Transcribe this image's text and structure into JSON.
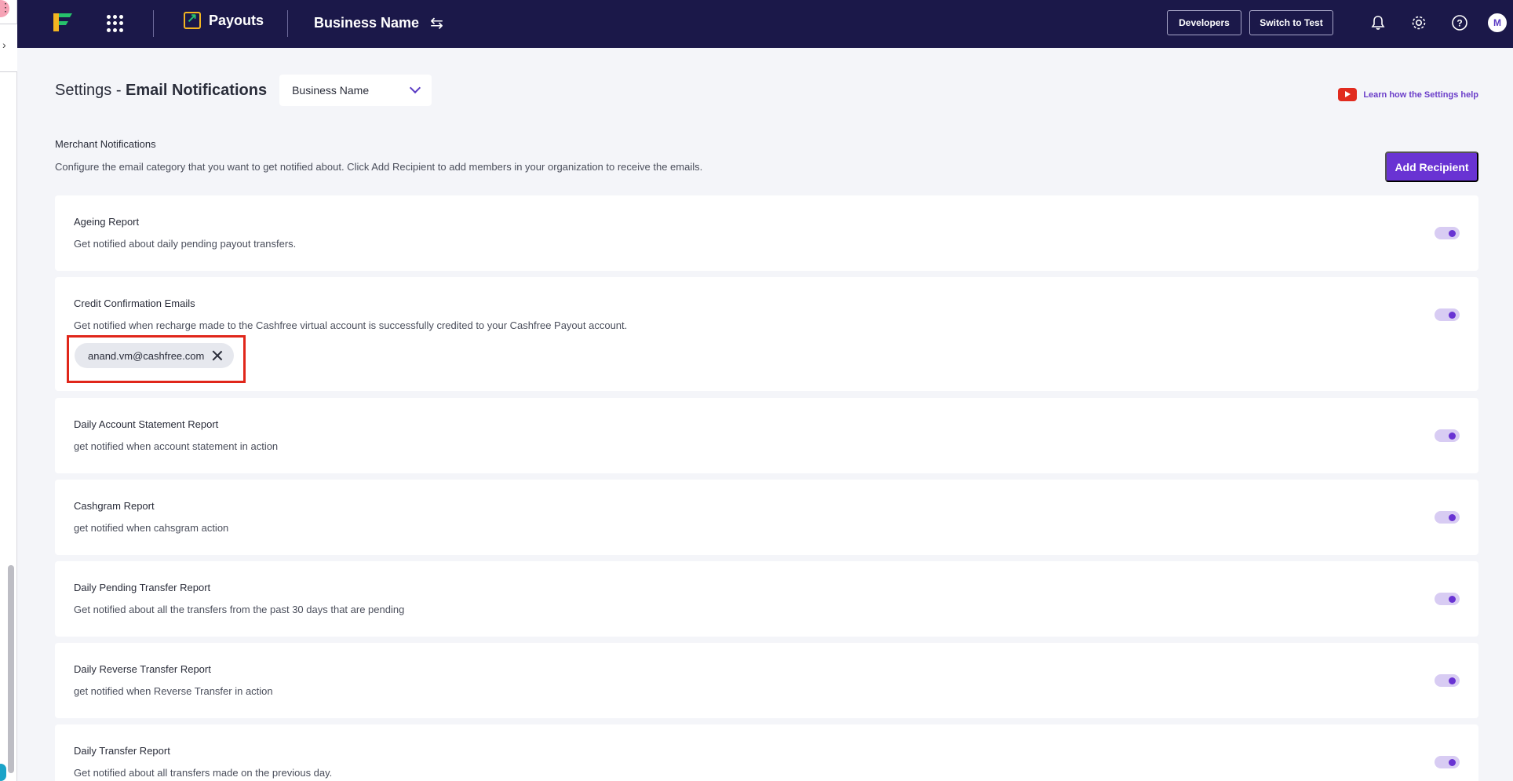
{
  "topbar": {
    "product": "Payouts",
    "business": "Business Name",
    "developers": "Developers",
    "switch_mode": "Switch to Test",
    "avatar_initial": "M"
  },
  "header": {
    "title_prefix": "Settings - ",
    "title_main": "Email Notifications",
    "business_select": "Business Name",
    "learn_link": "Learn how the Settings help"
  },
  "section": {
    "title": "Merchant Notifications",
    "description": "Configure the email category that you want to get notified about. Click Add Recipient to add members in your organization to receive the emails.",
    "add_button": "Add Recipient"
  },
  "notifications": [
    {
      "title": "Ageing Report",
      "desc": "Get notified about daily pending payout transfers.",
      "enabled": true
    },
    {
      "title": "Credit Confirmation Emails",
      "desc": "Get notified when recharge made to the Cashfree virtual account is successfully credited to your Cashfree Payout account.",
      "enabled": true,
      "recipient": "anand.vm@cashfree.com"
    },
    {
      "title": "Daily Account Statement Report",
      "desc": "get notified when account statement in action",
      "enabled": true
    },
    {
      "title": "Cashgram Report",
      "desc": "get notified when cahsgram action",
      "enabled": true
    },
    {
      "title": "Daily Pending Transfer Report",
      "desc": "Get notified about all the transfers from the past 30 days that are pending",
      "enabled": true
    },
    {
      "title": "Daily Reverse Transfer Report",
      "desc": "get notified when Reverse Transfer in action",
      "enabled": true
    },
    {
      "title": "Daily Transfer Report",
      "desc": "Get notified about all transfers made on the previous day.",
      "enabled": true
    }
  ],
  "colors": {
    "nav_bg": "#1b1849",
    "accent": "#6933d3",
    "highlight": "#e0261a"
  }
}
